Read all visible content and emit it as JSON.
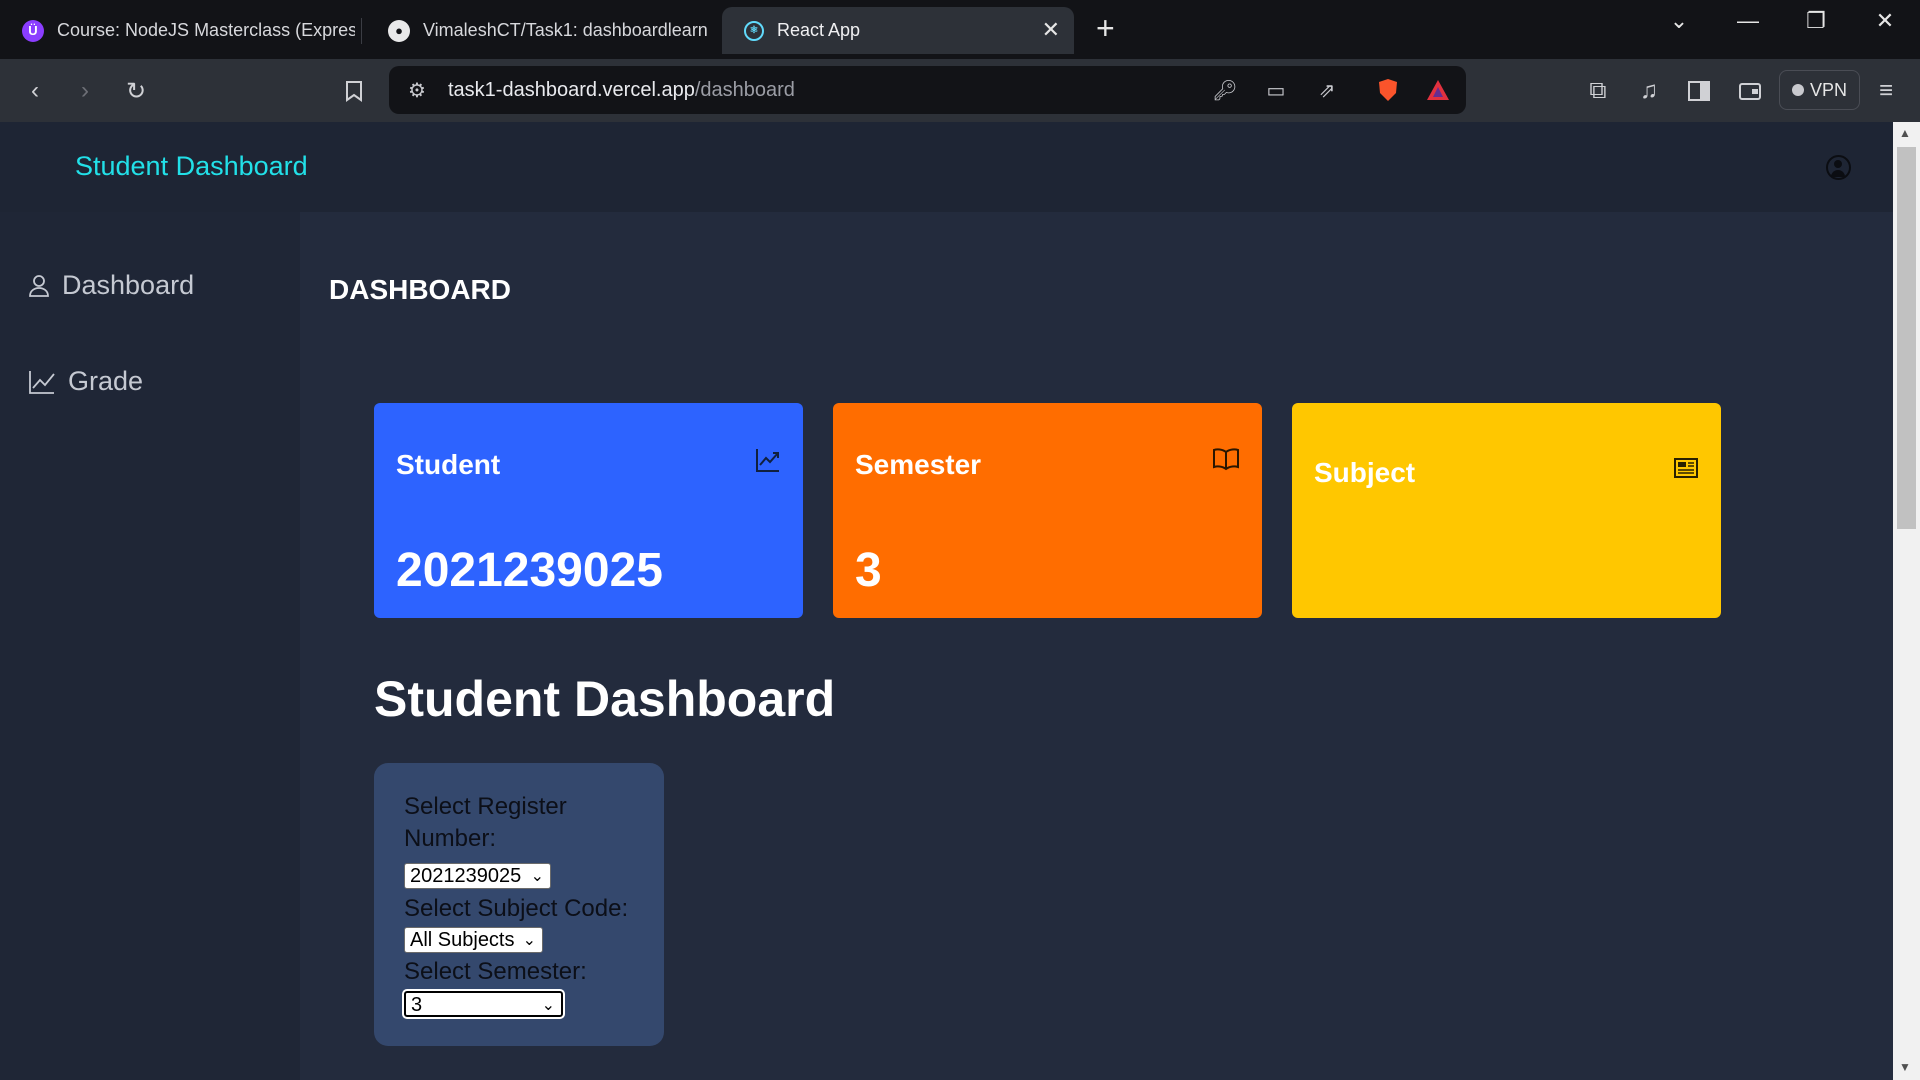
{
  "browser": {
    "tabs": [
      {
        "label": "Course: NodeJS Masterclass (Express",
        "active": false
      },
      {
        "label": "VimaleshCT/Task1: dashboardlearn",
        "active": false
      },
      {
        "label": "React App",
        "active": true
      }
    ],
    "url_host": "task1-dashboard.vercel.app",
    "url_path": "/dashboard",
    "vpn_label": "VPN"
  },
  "app": {
    "brand": "Student Dashboard",
    "sidebar": [
      {
        "label": "Dashboard",
        "icon": "user-icon"
      },
      {
        "label": "Grade",
        "icon": "chart-line-icon"
      }
    ],
    "page_title": "DASHBOARD",
    "cards": [
      {
        "title": "Student",
        "value": "2021239025",
        "color": "#2d63ff",
        "icon": "trending-up-icon"
      },
      {
        "title": "Semester",
        "value": "3",
        "color": "#ff6d00",
        "icon": "book-icon"
      },
      {
        "title": "Subject",
        "value": "",
        "color": "#ffc700",
        "icon": "newspaper-icon"
      }
    ],
    "section_title": "Student Dashboard",
    "filters": {
      "register_label": "Select Register Number:",
      "register_value": "2021239025",
      "subject_label": "Select Subject Code:",
      "subject_value": "All Subjects",
      "semester_label": "Select Semester:",
      "semester_value": "3"
    }
  }
}
